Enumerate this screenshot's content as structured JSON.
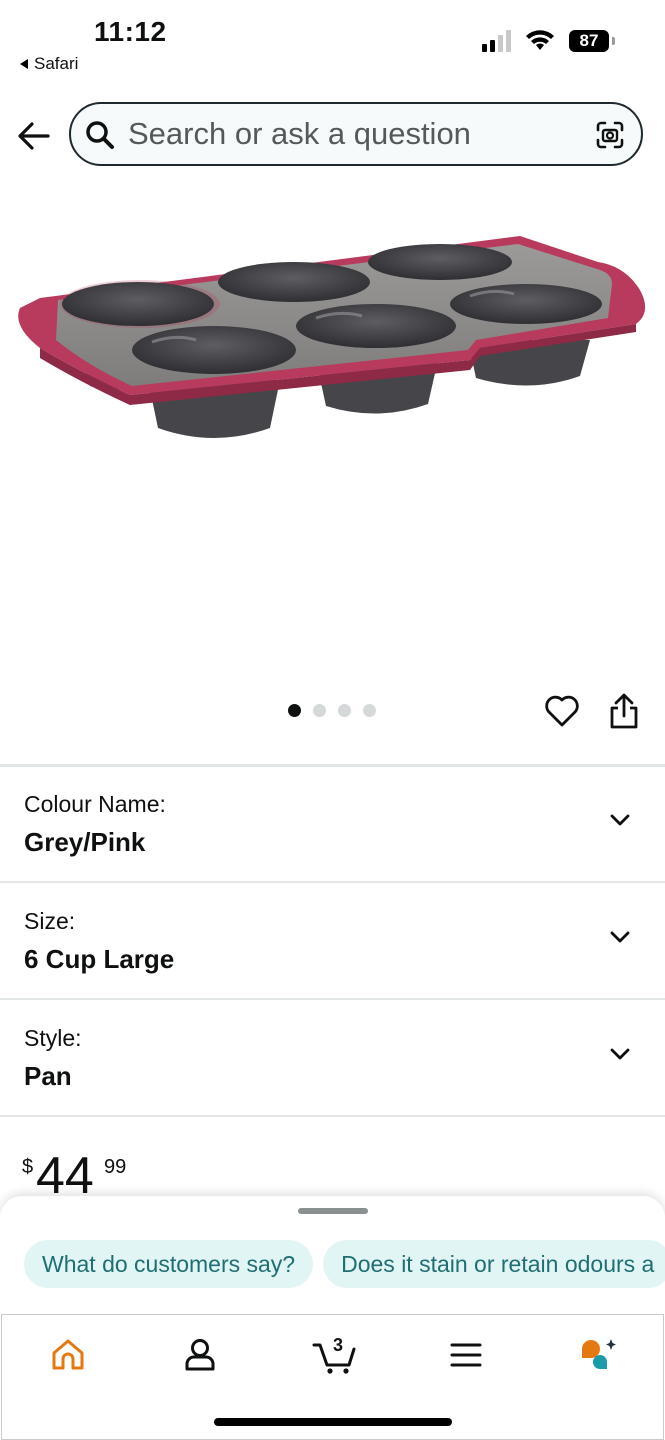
{
  "status_bar": {
    "time": "11:12",
    "back_app": "Safari",
    "battery": "87"
  },
  "search": {
    "placeholder": "Search or ask a question"
  },
  "gallery": {
    "image_count": 4,
    "active_index": 0
  },
  "variants": [
    {
      "label": "Colour Name:",
      "value": "Grey/Pink"
    },
    {
      "label": "Size:",
      "value": "6 Cup Large"
    },
    {
      "label": "Style:",
      "value": "Pan"
    }
  ],
  "price": {
    "currency": "$",
    "whole": "44",
    "fraction": "99"
  },
  "suggestions": [
    "What do customers say?",
    "Does it stain or retain odours a"
  ],
  "tabbar": {
    "items": [
      "home-icon",
      "account-icon",
      "cart-icon",
      "menu-icon",
      "rufus-icon"
    ],
    "cart_count": "3",
    "active": "home"
  },
  "colors": {
    "accent": "#e47911",
    "chip_bg": "#e1f5f5",
    "chip_text": "#1f6e73",
    "pan_rim": "#b83a5c",
    "pan_body": "#4a4a4d"
  }
}
